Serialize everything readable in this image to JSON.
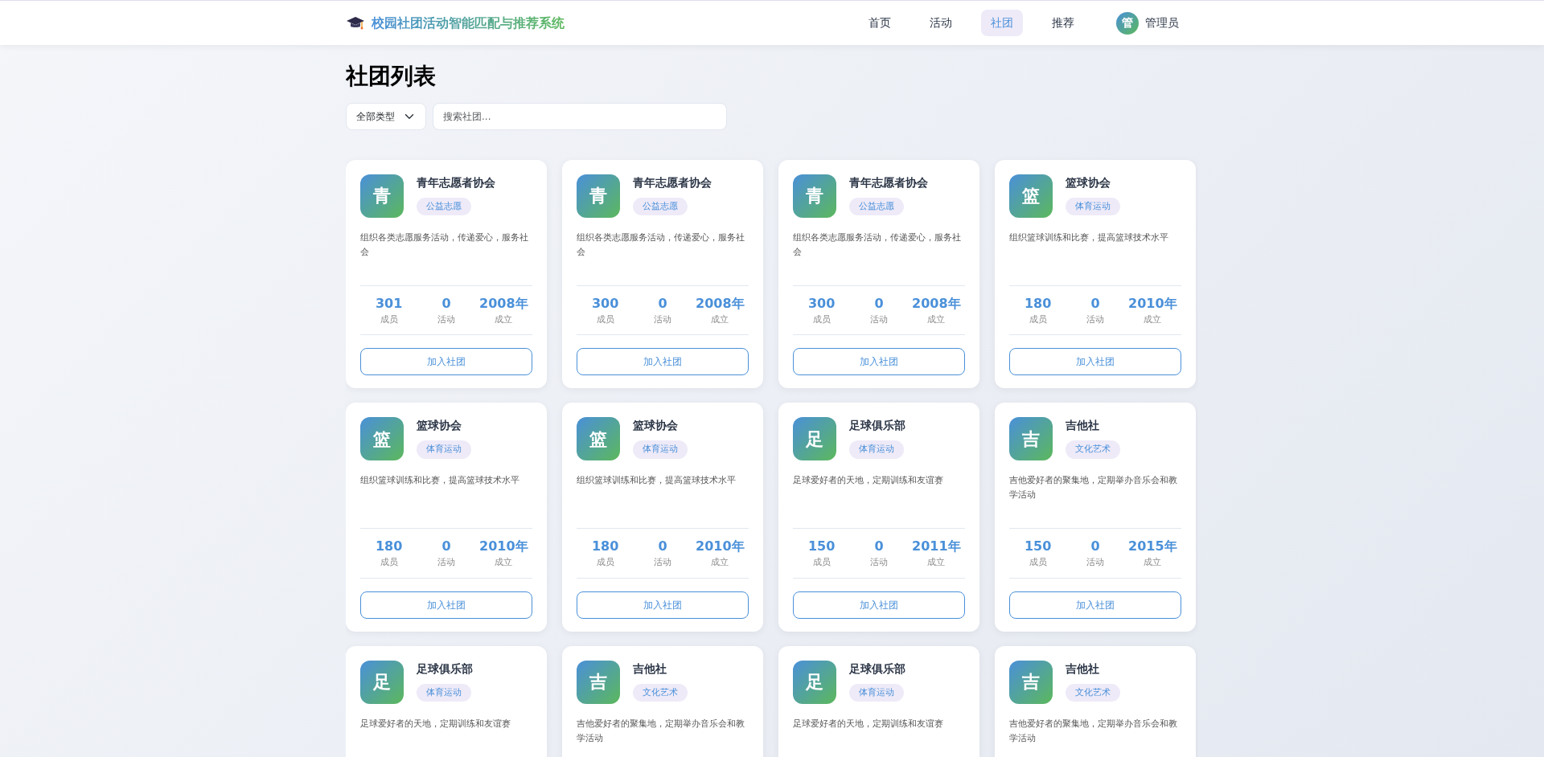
{
  "navbar": {
    "brand": "校园社团活动智能匹配与推荐系统",
    "links": [
      {
        "label": "首页",
        "selected": false
      },
      {
        "label": "活动",
        "selected": false
      },
      {
        "label": "社团",
        "selected": true
      },
      {
        "label": "推荐",
        "selected": false
      }
    ],
    "user": {
      "avatar": "管",
      "name": "管理员"
    }
  },
  "page_title": "社团列表",
  "filters": {
    "type_select": "全部类型",
    "search": {
      "placeholder": "搜索社团..."
    }
  },
  "clubs": [
    {
      "avatar": "青",
      "name": "青年志愿者协会",
      "tag": "公益志愿",
      "description": "组织各类志愿服务活动，传递爱心，服务社会",
      "stats": [
        {
          "value": "301",
          "label": "成员"
        },
        {
          "value": "0",
          "label": "活动"
        },
        {
          "value": "2008年",
          "label": "成立"
        }
      ],
      "button": "加入社团"
    },
    {
      "avatar": "青",
      "name": "青年志愿者协会",
      "tag": "公益志愿",
      "description": "组织各类志愿服务活动，传递爱心，服务社会",
      "stats": [
        {
          "value": "300",
          "label": "成员"
        },
        {
          "value": "0",
          "label": "活动"
        },
        {
          "value": "2008年",
          "label": "成立"
        }
      ],
      "button": "加入社团"
    },
    {
      "avatar": "青",
      "name": "青年志愿者协会",
      "tag": "公益志愿",
      "description": "组织各类志愿服务活动，传递爱心，服务社会",
      "stats": [
        {
          "value": "300",
          "label": "成员"
        },
        {
          "value": "0",
          "label": "活动"
        },
        {
          "value": "2008年",
          "label": "成立"
        }
      ],
      "button": "加入社团"
    },
    {
      "avatar": "篮",
      "name": "篮球协会",
      "tag": "体育运动",
      "description": "组织篮球训练和比赛，提高篮球技术水平",
      "stats": [
        {
          "value": "180",
          "label": "成员"
        },
        {
          "value": "0",
          "label": "活动"
        },
        {
          "value": "2010年",
          "label": "成立"
        }
      ],
      "button": "加入社团"
    },
    {
      "avatar": "篮",
      "name": "篮球协会",
      "tag": "体育运动",
      "description": "组织篮球训练和比赛，提高篮球技术水平",
      "stats": [
        {
          "value": "180",
          "label": "成员"
        },
        {
          "value": "0",
          "label": "活动"
        },
        {
          "value": "2010年",
          "label": "成立"
        }
      ],
      "button": "加入社团"
    },
    {
      "avatar": "篮",
      "name": "篮球协会",
      "tag": "体育运动",
      "description": "组织篮球训练和比赛，提高篮球技术水平",
      "stats": [
        {
          "value": "180",
          "label": "成员"
        },
        {
          "value": "0",
          "label": "活动"
        },
        {
          "value": "2010年",
          "label": "成立"
        }
      ],
      "button": "加入社团"
    },
    {
      "avatar": "足",
      "name": "足球俱乐部",
      "tag": "体育运动",
      "description": "足球爱好者的天地，定期训练和友谊赛",
      "stats": [
        {
          "value": "150",
          "label": "成员"
        },
        {
          "value": "0",
          "label": "活动"
        },
        {
          "value": "2011年",
          "label": "成立"
        }
      ],
      "button": "加入社团"
    },
    {
      "avatar": "吉",
      "name": "吉他社",
      "tag": "文化艺术",
      "description": "吉他爱好者的聚集地，定期举办音乐会和教学活动",
      "stats": [
        {
          "value": "150",
          "label": "成员"
        },
        {
          "value": "0",
          "label": "活动"
        },
        {
          "value": "2015年",
          "label": "成立"
        }
      ],
      "button": "加入社团"
    },
    {
      "avatar": "足",
      "name": "足球俱乐部",
      "tag": "体育运动",
      "description": "足球爱好者的天地，定期训练和友谊赛"
    },
    {
      "avatar": "吉",
      "name": "吉他社",
      "tag": "文化艺术",
      "description": "吉他爱好者的聚集地，定期举办音乐会和教学活动"
    },
    {
      "avatar": "足",
      "name": "足球俱乐部",
      "tag": "体育运动",
      "description": "足球爱好者的天地，定期训练和友谊赛"
    },
    {
      "avatar": "吉",
      "name": "吉他社",
      "tag": "文化艺术",
      "description": "吉他爱好者的聚集地，定期举办音乐会和教学活动"
    }
  ]
}
